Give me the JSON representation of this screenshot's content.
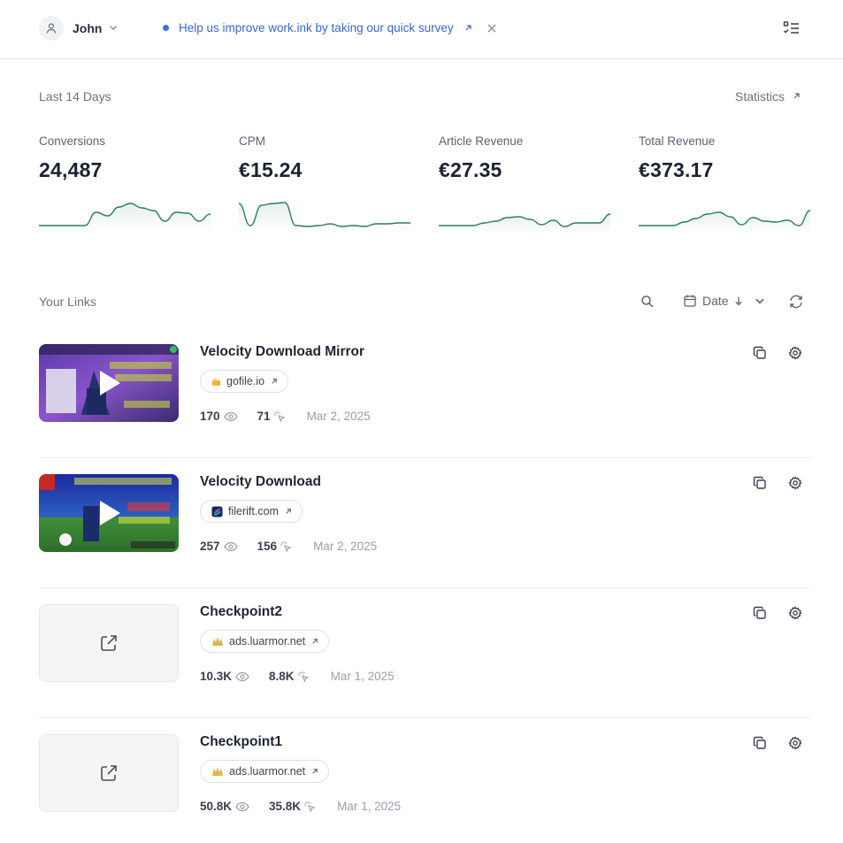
{
  "header": {
    "user_name": "John",
    "survey_text": "Help us improve work.ink by taking our quick survey"
  },
  "summary": {
    "period_label": "Last 14 Days",
    "statistics_link": "Statistics",
    "kpis": [
      {
        "label": "Conversions",
        "value": "24,487",
        "trend": [
          5,
          5,
          5,
          5,
          5,
          20,
          16,
          26,
          30,
          25,
          22,
          10,
          20,
          19,
          10,
          18
        ]
      },
      {
        "label": "CPM",
        "value": "€15.24",
        "trend": [
          30,
          5,
          28,
          30,
          31,
          5,
          4,
          5,
          7,
          4,
          5,
          4,
          7,
          7,
          8,
          8
        ]
      },
      {
        "label": "Article Revenue",
        "value": "€27.35",
        "trend": [
          5,
          5,
          5,
          5,
          8,
          10,
          14,
          15,
          12,
          6,
          11,
          4,
          8,
          8,
          8,
          18
        ]
      },
      {
        "label": "Total Revenue",
        "value": "€373.17",
        "trend": [
          5,
          5,
          5,
          5,
          9,
          13,
          18,
          20,
          15,
          6,
          14,
          10,
          9,
          11,
          5,
          22
        ]
      }
    ]
  },
  "links_section": {
    "title": "Your Links",
    "sort_label": "Date",
    "items": [
      {
        "title": "Velocity Download Mirror",
        "domain": "gofile.io",
        "views": "170",
        "clicks": "71",
        "date": "Mar 2, 2025",
        "thumb": "video-purple"
      },
      {
        "title": "Velocity Download",
        "domain": "filerift.com",
        "views": "257",
        "clicks": "156",
        "date": "Mar 2, 2025",
        "thumb": "video-green"
      },
      {
        "title": "Checkpoint2",
        "domain": "ads.luarmor.net",
        "views": "10.3K",
        "clicks": "8.8K",
        "date": "Mar 1, 2025",
        "thumb": "placeholder"
      },
      {
        "title": "Checkpoint1",
        "domain": "ads.luarmor.net",
        "views": "50.8K",
        "clicks": "35.8K",
        "date": "Mar 1, 2025",
        "thumb": "placeholder"
      }
    ]
  },
  "colors": {
    "accent_blue": "#3567d6",
    "trend_line": "#2e7d5b",
    "muted_text": "#6b7080"
  },
  "icons": [
    "user-icon",
    "chevron-down-icon",
    "external-link-icon",
    "close-icon",
    "checklist-menu-icon",
    "search-icon",
    "calendar-icon",
    "arrow-down-icon",
    "refresh-icon",
    "copy-icon",
    "gear-icon",
    "eye-icon",
    "click-icon",
    "play-icon"
  ]
}
